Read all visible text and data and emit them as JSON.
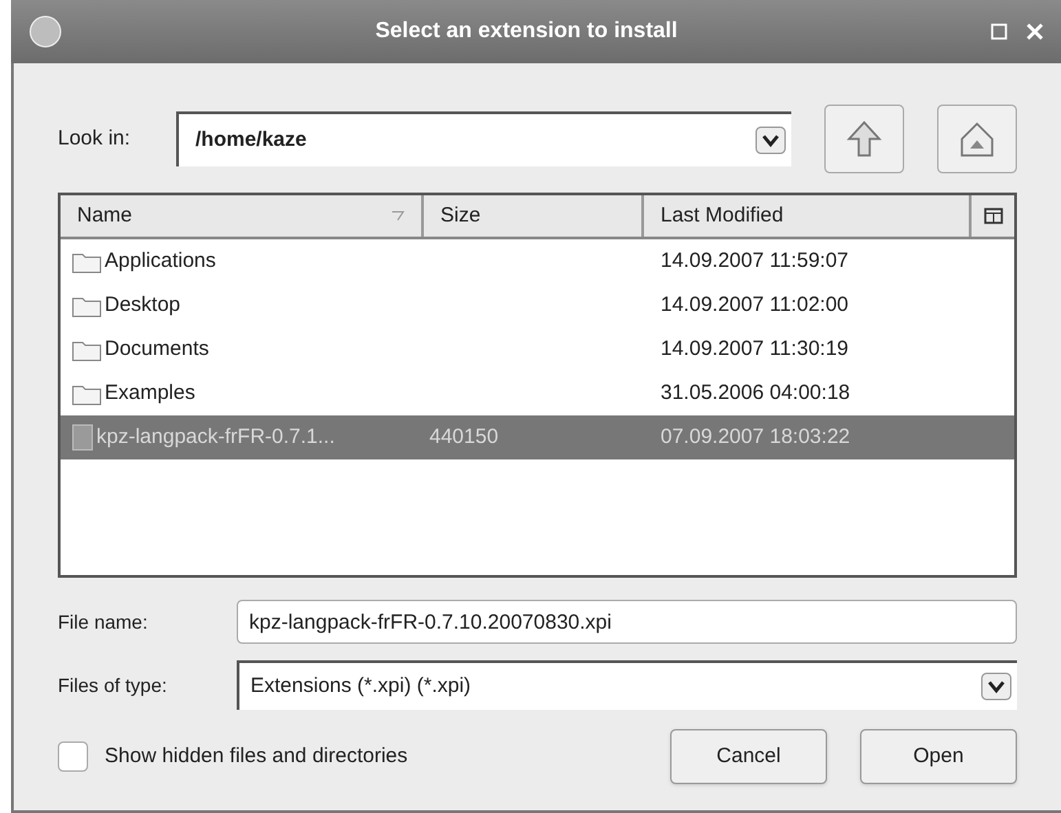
{
  "window": {
    "title": "Select an extension to install"
  },
  "look_in": {
    "label": "Look in:",
    "value": "/home/kaze"
  },
  "table": {
    "columns": [
      "Name",
      "Size",
      "Last Modified"
    ],
    "rows": [
      {
        "kind": "folder",
        "name": "Applications",
        "size": "",
        "modified": "14.09.2007 11:59:07",
        "selected": false
      },
      {
        "kind": "folder",
        "name": "Desktop",
        "size": "",
        "modified": "14.09.2007 11:02:00",
        "selected": false
      },
      {
        "kind": "folder",
        "name": "Documents",
        "size": "",
        "modified": "14.09.2007 11:30:19",
        "selected": false
      },
      {
        "kind": "folder",
        "name": "Examples",
        "size": "",
        "modified": "31.05.2006 04:00:18",
        "selected": false
      },
      {
        "kind": "file",
        "name": "kpz-langpack-frFR-0.7.1...",
        "size": "440150",
        "modified": "07.09.2007 18:03:22",
        "selected": true
      }
    ]
  },
  "file_name": {
    "label": "File name:",
    "value": "kpz-langpack-frFR-0.7.10.20070830.xpi"
  },
  "file_type": {
    "label": "Files of type:",
    "value": "Extensions (*.xpi) (*.xpi)"
  },
  "show_hidden": {
    "label": "Show hidden files and directories",
    "checked": false
  },
  "buttons": [
    "Cancel",
    "Open"
  ]
}
